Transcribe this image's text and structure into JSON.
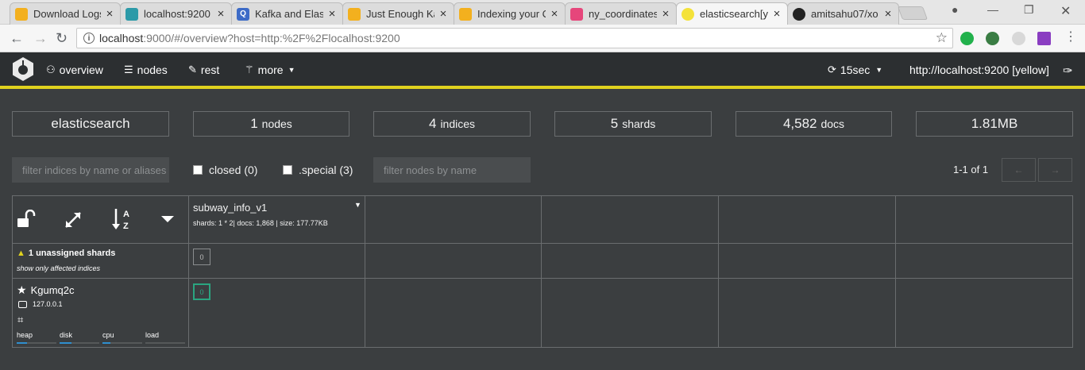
{
  "browser": {
    "tabs": [
      {
        "title": "Download Logs",
        "favicon_color": "#f3b01e",
        "active": false
      },
      {
        "title": "localhost:9200",
        "favicon_color": "#2c9aa8",
        "active": false
      },
      {
        "title": "Kafka and Elast",
        "favicon_color": "#3d6bc7",
        "active": false
      },
      {
        "title": "Just Enough Ka",
        "favicon_color": "#f3b01e",
        "active": false
      },
      {
        "title": "Indexing your C",
        "favicon_color": "#f3b01e",
        "active": false
      },
      {
        "title": "ny_coordinates",
        "favicon_color": "#e6467b",
        "active": false
      },
      {
        "title": "elasticsearch[ye",
        "favicon_color": "#f4e23a",
        "active": true
      },
      {
        "title": "amitsahu07/xo",
        "favicon_color": "#222222",
        "active": false
      }
    ],
    "address": {
      "host": "localhost",
      "path": ":9000/#/overview?host=http:%2F%2Flocalhost:9200"
    }
  },
  "app": {
    "nav": {
      "overview": "overview",
      "nodes": "nodes",
      "rest": "rest",
      "more": "more"
    },
    "refresh": "15sec",
    "cluster_url": "http://localhost:9200 [yellow]",
    "accent_color": "#e0d21e"
  },
  "stats": {
    "cluster_name": "elasticsearch",
    "nodes_value": "1",
    "nodes_label": "nodes",
    "indices_value": "4",
    "indices_label": "indices",
    "shards_value": "5",
    "shards_label": "shards",
    "docs_value": "4,582",
    "docs_label": "docs",
    "size": "1.81MB"
  },
  "filters": {
    "indices_placeholder": "filter indices by name or aliases",
    "closed_label": "closed (0)",
    "special_label": ".special (3)",
    "nodes_placeholder": "filter nodes by name",
    "pagination": "1-1 of 1",
    "prev": "←",
    "next": "→"
  },
  "grid": {
    "index": {
      "name": "subway_info_v1",
      "meta": "shards: 1 * 2| docs: 1,868 | size: 177.77KB"
    },
    "unassigned": {
      "label": "1 unassigned shards",
      "link": "show only affected indices",
      "shard": "0"
    },
    "node": {
      "name": "Kgumq2c",
      "ip": "127.0.0.1",
      "shard": "0",
      "metrics": [
        {
          "label": "heap",
          "fill": 0.25
        },
        {
          "label": "disk",
          "fill": 0.3
        },
        {
          "label": "cpu",
          "fill": 0.2
        },
        {
          "label": "load",
          "fill": 0.0
        }
      ]
    }
  }
}
